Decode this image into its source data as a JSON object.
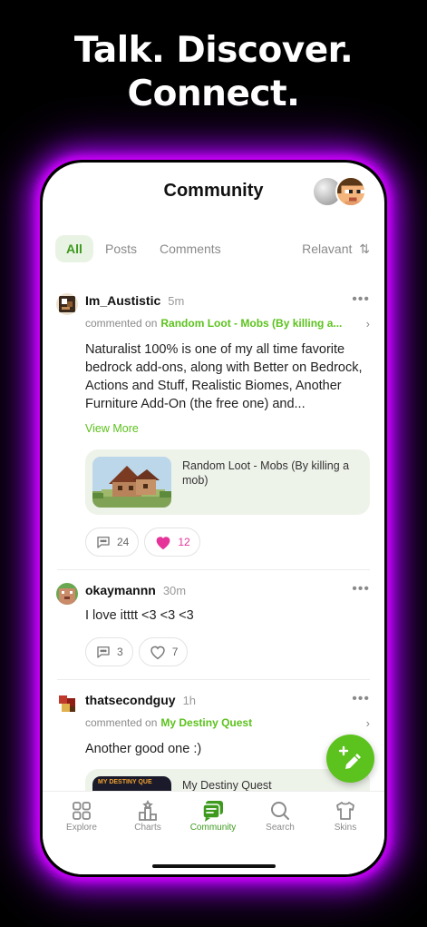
{
  "hero": {
    "line1": "Talk. Discover.",
    "line2": "Connect."
  },
  "header": {
    "title": "Community"
  },
  "tabs": {
    "all": "All",
    "posts": "Posts",
    "comments": "Comments",
    "sort": "Relavant"
  },
  "posts": [
    {
      "username": "Im_Austistic",
      "time": "5m",
      "commented_on_label": "commented on",
      "target": "Random Loot - Mobs (By killing a...",
      "text": "Naturalist 100% is one of my all time favorite bedrock add-ons, along with Better on Bedrock, Actions and Stuff, Realistic Biomes, Another Furniture Add-On (the free one) and...",
      "view_more": "View More",
      "card_title": "Random Loot - Mobs (By killing a mob)",
      "comments": "24",
      "likes": "12"
    },
    {
      "username": "okaymannn",
      "time": "30m",
      "text": "I love itttt <3 <3 <3",
      "comments": "3",
      "likes": "7"
    },
    {
      "username": "thatsecondguy",
      "time": "1h",
      "commented_on_label": "commented on",
      "target": "My Destiny Quest",
      "text": "Another good one :)",
      "card_title": "My Destiny Quest",
      "thumb_text": "MY DESTINY QUE"
    }
  ],
  "tabbar": {
    "explore": "Explore",
    "charts": "Charts",
    "community": "Community",
    "search": "Search",
    "skins": "Skins"
  },
  "colors": {
    "accent": "#5cc21d",
    "like": "#e6339a",
    "glow": "#c000ff"
  }
}
